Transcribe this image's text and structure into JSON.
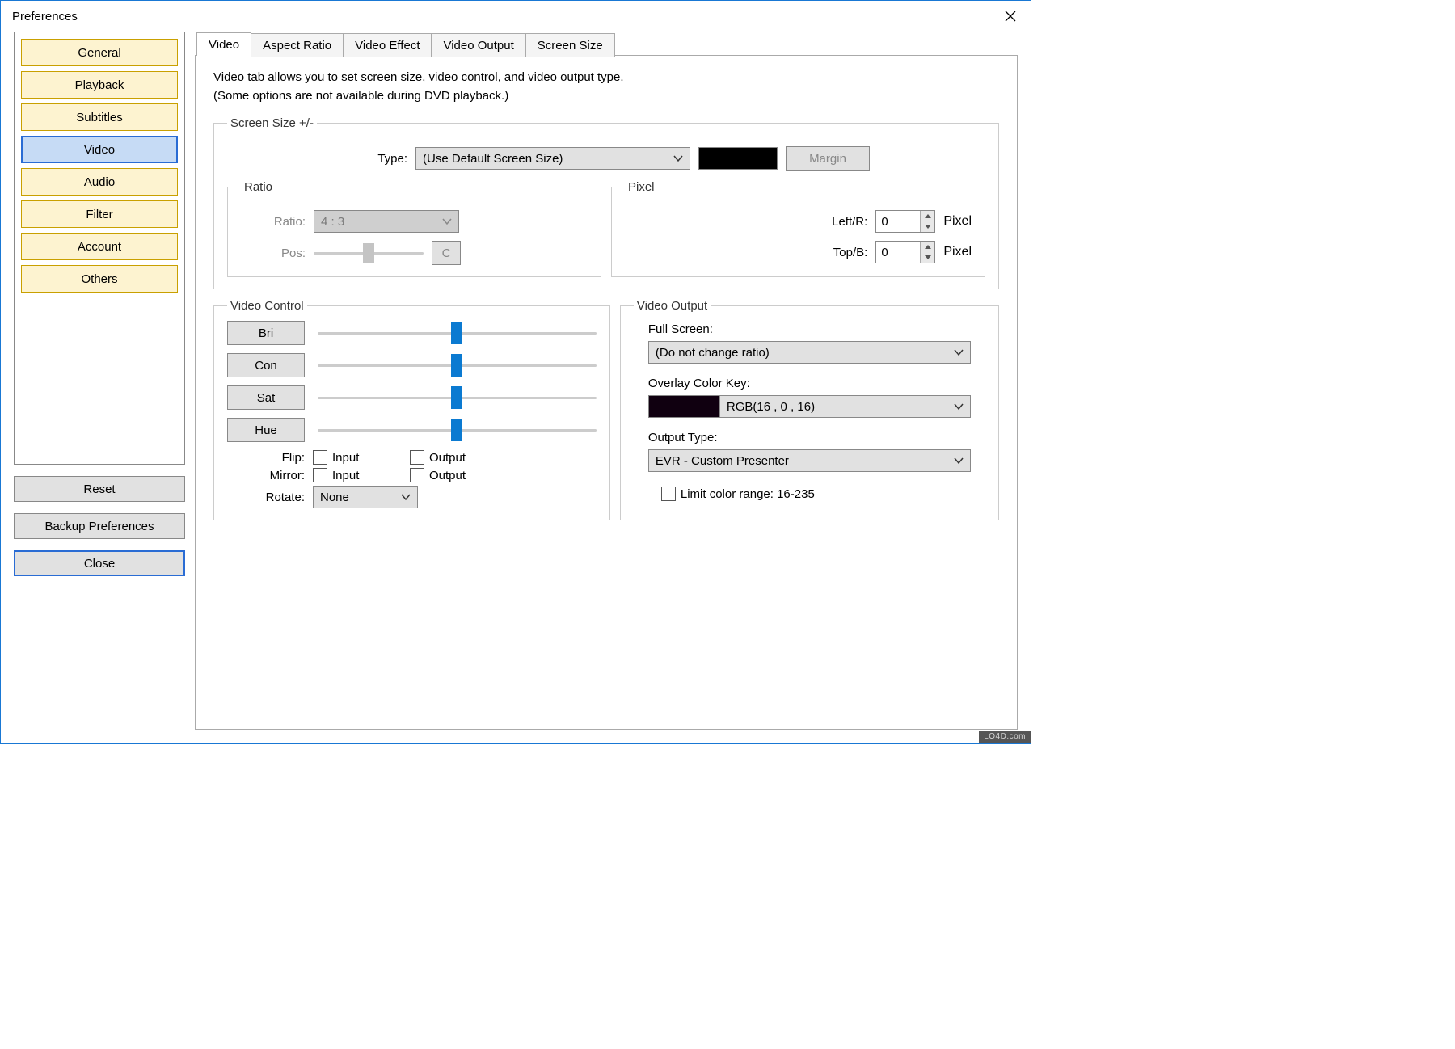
{
  "window": {
    "title": "Preferences"
  },
  "nav": {
    "items": [
      "General",
      "Playback",
      "Subtitles",
      "Video",
      "Audio",
      "Filter",
      "Account",
      "Others"
    ],
    "selected_index": 3
  },
  "side_buttons": {
    "reset": "Reset",
    "backup": "Backup Preferences",
    "close": "Close"
  },
  "tabs": {
    "items": [
      "Video",
      "Aspect Ratio",
      "Video Effect",
      "Video Output",
      "Screen Size"
    ],
    "active_index": 0
  },
  "desc": {
    "line1": "Video tab allows you to set screen size, video control, and video output type.",
    "line2": "(Some options are not available during DVD playback.)"
  },
  "screen_size": {
    "legend": "Screen Size +/-",
    "type_label": "Type:",
    "type_value": "(Use Default Screen Size)",
    "margin_btn": "Margin"
  },
  "ratio": {
    "legend": "Ratio",
    "ratio_label": "Ratio:",
    "ratio_value": "4 : 3",
    "pos_label": "Pos:",
    "c_btn": "C"
  },
  "pixel": {
    "legend": "Pixel",
    "left_label": "Left/R:",
    "left_value": "0",
    "top_label": "Top/B:",
    "top_value": "0",
    "unit": "Pixel"
  },
  "video_control": {
    "legend": "Video Control",
    "bri": "Bri",
    "con": "Con",
    "sat": "Sat",
    "hue": "Hue",
    "flip_label": "Flip:",
    "mirror_label": "Mirror:",
    "rotate_label": "Rotate:",
    "input": "Input",
    "output": "Output",
    "rotate_value": "None"
  },
  "video_output": {
    "legend": "Video Output",
    "fullscreen_label": "Full Screen:",
    "fullscreen_value": "(Do not change ratio)",
    "overlay_label": "Overlay Color Key:",
    "overlay_value": "RGB(16 , 0 , 16)",
    "overlay_color": "#100010",
    "output_type_label": "Output Type:",
    "output_type_value": "EVR - Custom Presenter",
    "limit_label": "Limit color range: 16-235"
  },
  "footer_brand": "LO4D.com"
}
